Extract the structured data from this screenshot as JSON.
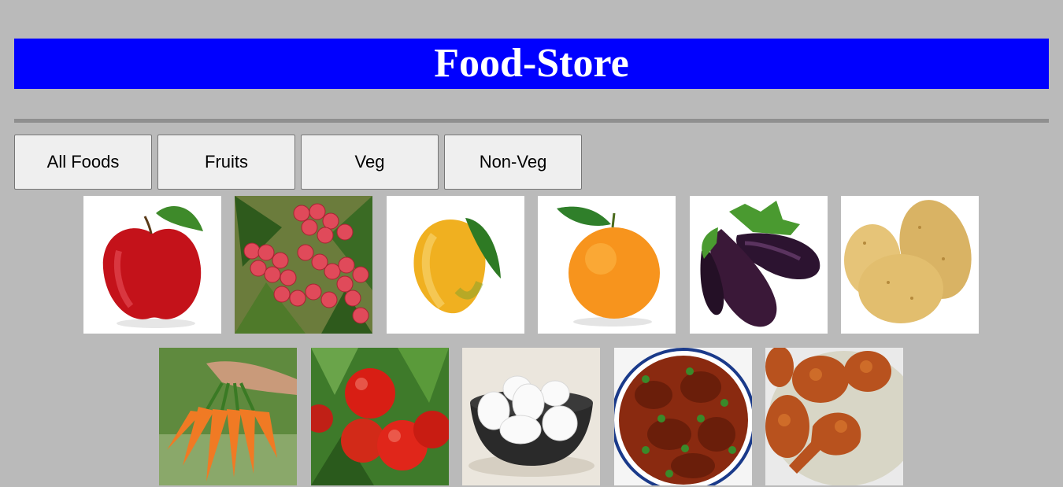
{
  "header": {
    "title": "Food-Store"
  },
  "tabs": [
    {
      "label": "All Foods"
    },
    {
      "label": "Fruits"
    },
    {
      "label": "Veg"
    },
    {
      "label": "Non-Veg"
    }
  ],
  "products": [
    {
      "name": "apple",
      "category": "fruit"
    },
    {
      "name": "lychee",
      "category": "fruit"
    },
    {
      "name": "mango",
      "category": "fruit"
    },
    {
      "name": "orange",
      "category": "fruit"
    },
    {
      "name": "eggplant",
      "category": "veg"
    },
    {
      "name": "potato",
      "category": "veg"
    },
    {
      "name": "carrot",
      "category": "veg"
    },
    {
      "name": "tomato",
      "category": "veg"
    },
    {
      "name": "egg",
      "category": "non-veg"
    },
    {
      "name": "curry",
      "category": "non-veg"
    },
    {
      "name": "fried-chicken",
      "category": "non-veg"
    }
  ],
  "colors": {
    "header_bg": "#0000ff",
    "header_text": "#ffffff",
    "page_bg": "#bababa"
  }
}
